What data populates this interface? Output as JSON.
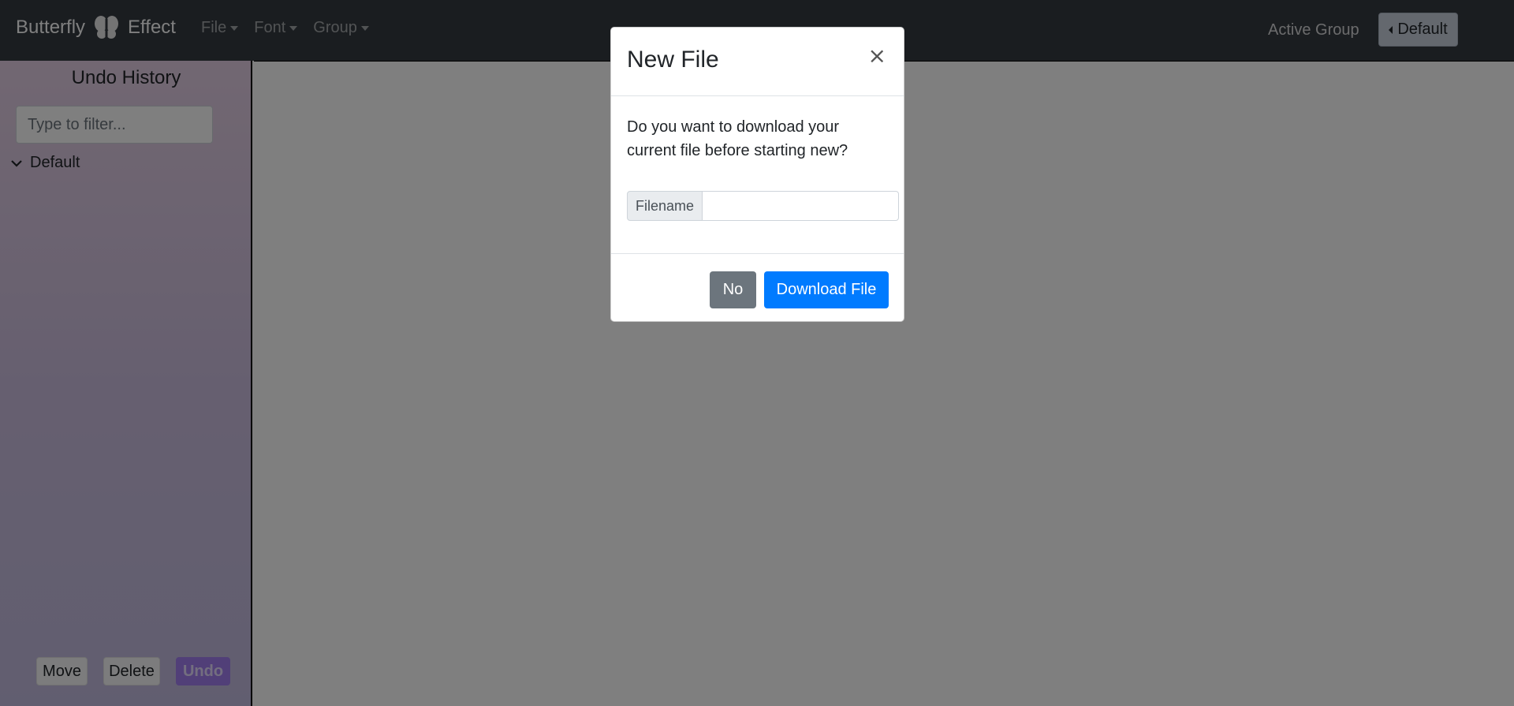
{
  "navbar": {
    "brand_left": "Butterfly",
    "brand_right": "Effect",
    "logo_icon": "butterfly-icon",
    "menus": [
      "File",
      "Font",
      "Group"
    ],
    "active_group_label": "Active Group",
    "active_group_button": "Default"
  },
  "sidebar": {
    "title": "Undo History",
    "filter_placeholder": "Type to filter...",
    "tree_items": [
      {
        "label": "Default",
        "expanded": true
      }
    ],
    "buttons": {
      "move": "Move",
      "delete": "Delete",
      "undo": "Undo"
    }
  },
  "modal": {
    "title": "New File",
    "close_symbol": "×",
    "message": "Do you want to download your current file before starting new?",
    "filename_label": "Filename",
    "filename_value": "",
    "no_button": "No",
    "download_button": "Download File"
  },
  "colors": {
    "navbar_bg": "#343a40",
    "primary": "#007bff",
    "secondary": "#6c757d",
    "undo_accent": "#a27ff0"
  }
}
